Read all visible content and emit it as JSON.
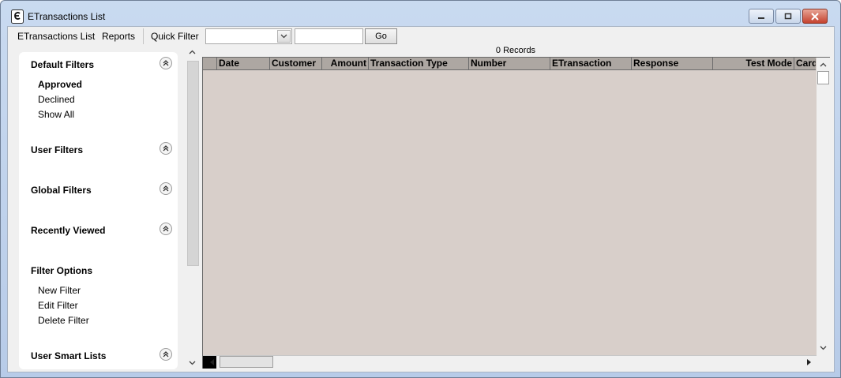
{
  "window": {
    "title": "ETransactions List",
    "icon": "etransaction-app-icon"
  },
  "menu": {
    "etransactions_list": "ETransactions List",
    "reports": "Reports",
    "quick_filter_label": "Quick Filter",
    "quick_filter_value": "",
    "quick_filter_text": "",
    "go_label": "Go"
  },
  "sidebar": {
    "default_filters": {
      "title": "Default Filters",
      "items": [
        "Approved",
        "Declined",
        "Show All"
      ],
      "selected": "Approved"
    },
    "user_filters": {
      "title": "User Filters"
    },
    "global_filters": {
      "title": "Global Filters"
    },
    "recently_viewed": {
      "title": "Recently Viewed"
    },
    "filter_options": {
      "title": "Filter Options",
      "items": [
        "New Filter",
        "Edit Filter",
        "Delete Filter"
      ]
    },
    "user_smart_lists": {
      "title": "User Smart Lists"
    }
  },
  "grid": {
    "record_count": "0 Records",
    "columns": [
      "Date",
      "Customer",
      "Amount",
      "Transaction Type",
      "Number",
      "ETransaction",
      "Response",
      "Test Mode",
      "Card"
    ],
    "rows": []
  },
  "colors": {
    "grid_background": "#d8cfca",
    "header_background": "#ada7a2",
    "window_chrome": "#c9daf0"
  }
}
